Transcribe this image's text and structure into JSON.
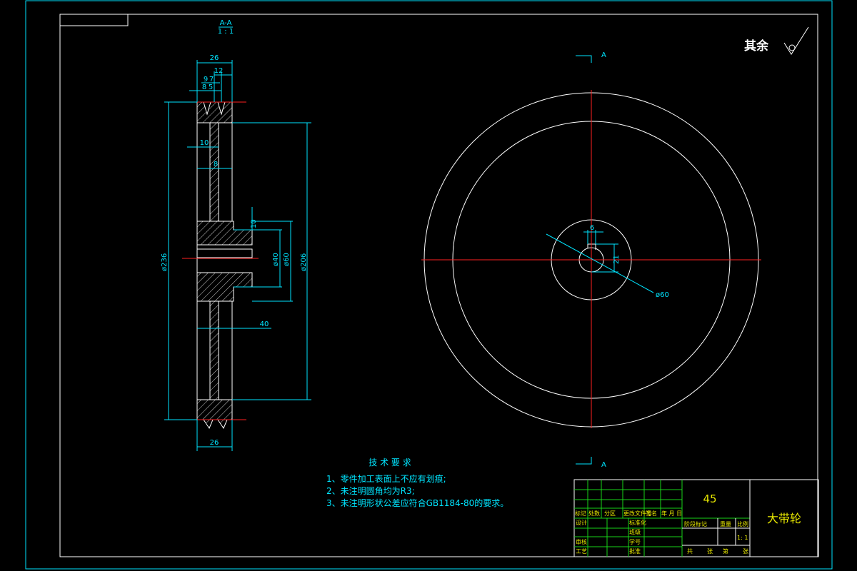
{
  "section": {
    "label": "A-A",
    "scale": "1 : 1"
  },
  "roughness": {
    "label": "其余"
  },
  "side_view": {
    "dims": {
      "width_top": "26",
      "g12": "12",
      "g9": "9",
      "g7": "7",
      "g8": "8",
      "g5": "5",
      "web_thick": "10",
      "web_offset": "8",
      "hub_step": "10",
      "bore": "ø40",
      "hub_dia": "ø60",
      "pitch_dia": "ø206",
      "outer_dia": "ø236",
      "hub_len": "40",
      "width_bottom": "26"
    }
  },
  "front_view": {
    "dims": {
      "key_width": "6",
      "key_depth": "21",
      "hub_dia": "ø60"
    },
    "section_marks": {
      "top": "A",
      "bottom": "A"
    }
  },
  "tech_req": {
    "title": "技 术 要 求",
    "items": [
      "1、零件加工表面上不应有划痕;",
      "2、未注明圆角均为R3;",
      "3、未注明形状公差应符合GB1184-80的要求。"
    ]
  },
  "title_block": {
    "material": "45",
    "part_name": "大带轮",
    "scale": "1: 1",
    "labels": {
      "marker": "标记",
      "count": "处数",
      "zone": "分区",
      "doc_no": "更改文件号",
      "sign": "签名",
      "date": "年 月 日",
      "design": "设计",
      "std": "标准化",
      "review": "审核",
      "craft": "工艺",
      "approve": "批准",
      "class": "班级",
      "student_no": "学号",
      "stage": "阶段标记",
      "weight": "重量",
      "ratio": "比例",
      "total": "共",
      "sheet": "张",
      "nth": "第",
      "sheet2": "张"
    }
  }
}
